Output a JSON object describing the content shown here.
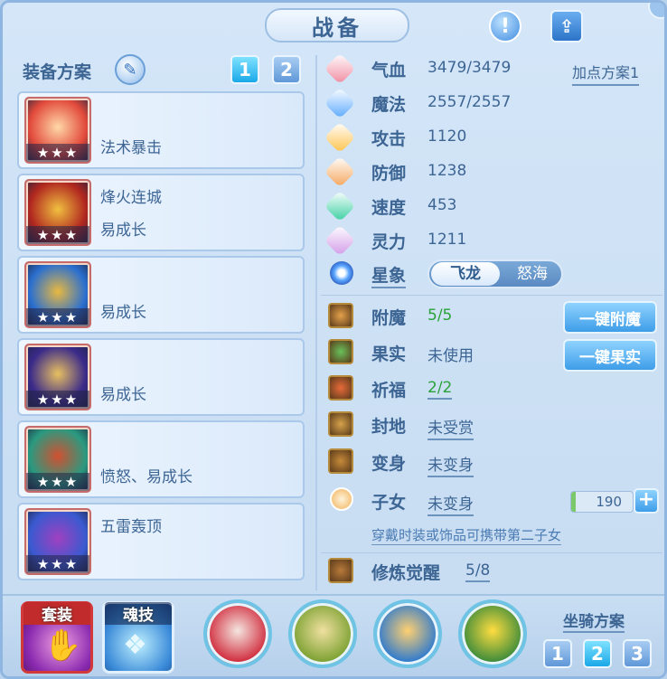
{
  "header": {
    "title": "战备",
    "help_glyph": "!",
    "share_glyph": "⇪"
  },
  "equipment_plan": {
    "label": "装备方案",
    "edit_glyph": "✎",
    "tabs": [
      "1",
      "2"
    ],
    "selected_tab": "1"
  },
  "equipment": [
    {
      "line1": "",
      "line2": "法术暴击",
      "stars": "★★★",
      "colors": [
        "#e24a3b",
        "#ffd8a8"
      ]
    },
    {
      "line1": "烽火连城",
      "line2": "易成长",
      "stars": "★★★",
      "colors": [
        "#b0261f",
        "#f0c040"
      ]
    },
    {
      "line1": "",
      "line2": "易成长",
      "stars": "★★★",
      "colors": [
        "#2a6fd0",
        "#e8b840"
      ]
    },
    {
      "line1": "",
      "line2": "易成长",
      "stars": "★★★",
      "colors": [
        "#3a2a8a",
        "#e8c060"
      ]
    },
    {
      "line1": "",
      "line2": "愤怒、易成长",
      "stars": "★★★",
      "colors": [
        "#2a9a80",
        "#d05030"
      ]
    },
    {
      "line1": "五雷轰顶",
      "line2": "",
      "stars": "★★★",
      "colors": [
        "#3a5ad0",
        "#a040c0"
      ]
    }
  ],
  "stats": [
    {
      "label": "气血",
      "value": "3479/3479",
      "icon": "heart-icon",
      "color": "#f08aa0"
    },
    {
      "label": "魔法",
      "value": "2557/2557",
      "icon": "mana-icon",
      "color": "#5aa8ff"
    },
    {
      "label": "攻击",
      "value": "1120",
      "icon": "sword-icon",
      "color": "#ffc24a"
    },
    {
      "label": "防御",
      "value": "1238",
      "icon": "shield-icon",
      "color": "#f5a45a"
    },
    {
      "label": "速度",
      "value": "453",
      "icon": "lightning-icon",
      "color": "#38cfa0"
    },
    {
      "label": "灵力",
      "value": "1211",
      "icon": "spirit-icon",
      "color": "#d39ae8"
    }
  ],
  "plus_plan": "加点方案1",
  "star_sign": {
    "label": "星象",
    "option_a": "飞龙",
    "option_b": "怒海",
    "selected": "飞龙"
  },
  "attributes": [
    {
      "label": "附魔",
      "value": "5/5",
      "green": true,
      "underline": false,
      "icon": "enchant-icon",
      "color": "#e4a14b"
    },
    {
      "label": "果实",
      "value": "未使用",
      "green": false,
      "underline": false,
      "icon": "fruit-icon",
      "color": "#69c15a"
    },
    {
      "label": "祈福",
      "value": "2/2",
      "green": true,
      "underline": true,
      "icon": "blessing-icon",
      "color": "#e86a3a"
    },
    {
      "label": "封地",
      "value": "未受赏",
      "green": false,
      "underline": true,
      "icon": "fief-icon",
      "color": "#d6a24a"
    },
    {
      "label": "变身",
      "value": "未变身",
      "green": false,
      "underline": true,
      "icon": "transform-icon",
      "color": "#c68a3a"
    },
    {
      "label": "子女",
      "value": "未变身",
      "green": false,
      "underline": true,
      "icon": "child-icon",
      "color": "#f0b25a"
    },
    {
      "label": "修炼觉醒",
      "value": "5/8",
      "green": false,
      "underline": true,
      "icon": "cultivation-icon",
      "color": "#b87a3a"
    }
  ],
  "buttons": {
    "enchant_all": "一键附魔",
    "fruit_all": "一键果实"
  },
  "child_counter": {
    "value": "190",
    "fill_fraction": 0.08,
    "plus_glyph": "+"
  },
  "hint": "穿戴时装或饰品可携带第二子女",
  "bottom": {
    "suit_label": "套装",
    "soul_skill_label": "魂技",
    "orbs": [
      {
        "icon": "petal-orb-icon",
        "colors": [
          "#f4e6e0",
          "#d0283a"
        ]
      },
      {
        "icon": "figure-orb-icon",
        "colors": [
          "#f0e0a0",
          "#7aa030"
        ]
      },
      {
        "icon": "wave-orb-icon",
        "colors": [
          "#ffd070",
          "#2a78d0"
        ]
      },
      {
        "icon": "leaf-orb-icon",
        "colors": [
          "#ffdd40",
          "#3a8a3a"
        ]
      }
    ],
    "mount_plan_label": "坐骑方案",
    "mount_tabs": [
      "1",
      "2",
      "3"
    ],
    "mount_selected": "2"
  }
}
